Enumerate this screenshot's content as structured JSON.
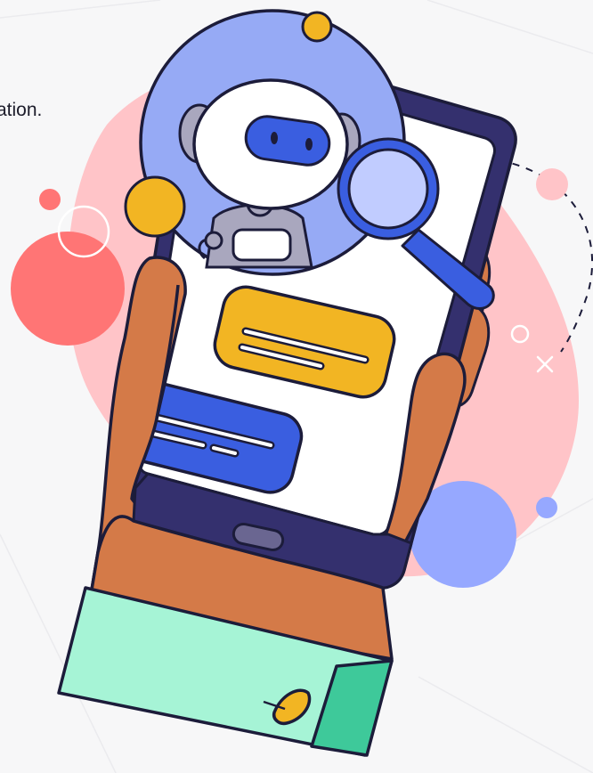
{
  "caption": {
    "text": "ation."
  },
  "colors": {
    "background": "#f7f7f8",
    "blob_pink": "#ffc4c8",
    "blob_coral": "#ff7575",
    "blob_periwinkle": "#96a8ff",
    "robot_bubble": "#96aaf5",
    "phone_body": "#34306e",
    "phone_screen": "#ffffff",
    "chat_yellow": "#f2b523",
    "chat_blue": "#3a5ee0",
    "hand_skin": "#d47a48",
    "cuff_light": "#a6f4d6",
    "cuff_dark": "#3ec99a",
    "outline": "#1c1c3a"
  },
  "icons": {
    "robot": "robot-icon",
    "magnifier": "magnifying-glass-icon",
    "phone": "smartphone-icon",
    "chat_bubble": "chat-bubble-icon"
  }
}
